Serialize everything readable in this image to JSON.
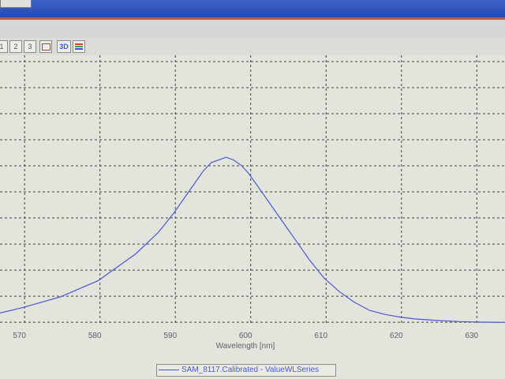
{
  "toolbar": {
    "buttons": [
      "1",
      "2",
      "3",
      "",
      "3D",
      ""
    ],
    "three_d_label": "3D"
  },
  "colors": {
    "series": "#4a5ad0",
    "grid": "#3f4248",
    "plot_background": "#e3e4dc"
  },
  "chart_data": {
    "type": "line",
    "xlabel": "Wavelength [nm]",
    "ylabel": "",
    "xlim": [
      567,
      634
    ],
    "ylim": [
      0,
      1
    ],
    "xticks": [
      570,
      580,
      590,
      600,
      610,
      620,
      630
    ],
    "yticks_labeled": false,
    "grid": true,
    "legend": "bottom-center",
    "series": [
      {
        "name": "SAM_8117.Calibrated - ValueWLSeries",
        "x": [
          567,
          570,
          575,
          580,
          585,
          588,
          590,
          592,
          594,
          595,
          596,
          597,
          598,
          599,
          600,
          602,
          604,
          606,
          608,
          610,
          612,
          614,
          616,
          618,
          620,
          622,
          625,
          628,
          631,
          634
        ],
        "y": [
          0.04,
          0.06,
          0.1,
          0.16,
          0.26,
          0.34,
          0.41,
          0.49,
          0.57,
          0.6,
          0.61,
          0.62,
          0.61,
          0.59,
          0.56,
          0.48,
          0.4,
          0.32,
          0.24,
          0.17,
          0.12,
          0.08,
          0.05,
          0.035,
          0.025,
          0.018,
          0.012,
          0.008,
          0.006,
          0.005
        ]
      }
    ]
  }
}
